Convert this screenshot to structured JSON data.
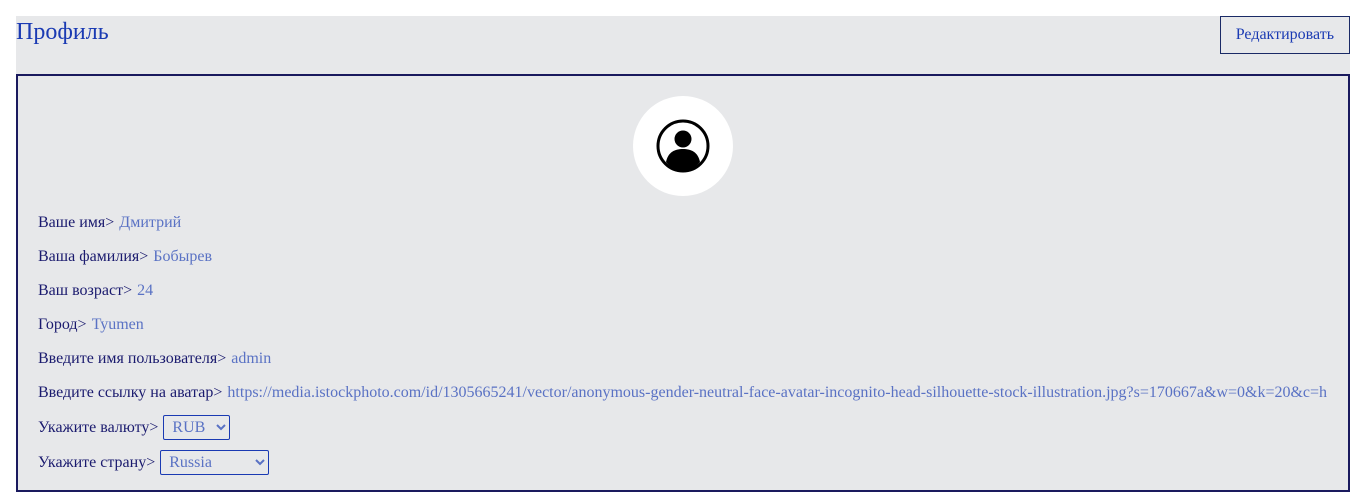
{
  "header": {
    "title": "Профиль",
    "edit_label": "Редактировать"
  },
  "profile": {
    "avatar_icon": "user-avatar-icon",
    "fields": [
      {
        "label": "Ваше имя",
        "value": "Дмитрий"
      },
      {
        "label": "Ваша фамилия",
        "value": "Бобырев"
      },
      {
        "label": "Ваш возраст",
        "value": "24"
      },
      {
        "label": "Город",
        "value": "Tyumen"
      },
      {
        "label": "Введите имя пользователя",
        "value": "admin"
      },
      {
        "label": "Введите ссылку на аватар",
        "value": "https://media.istockphoto.com/id/1305665241/vector/anonymous-gender-neutral-face-avatar-incognito-head-silhouette-stock-illustration.jpg?s=170667a&w=0&k=20&c=h"
      }
    ],
    "currency": {
      "label": "Укажите валюту",
      "selected": "RUB"
    },
    "country": {
      "label": "Укажите страну",
      "selected": "Russia"
    }
  },
  "separator": ">",
  "colors": {
    "title": "#1a3ab3",
    "label": "#1a1a6e",
    "value": "#5a72c4",
    "background": "#e7e8ea",
    "border": "#1a1a5e"
  }
}
